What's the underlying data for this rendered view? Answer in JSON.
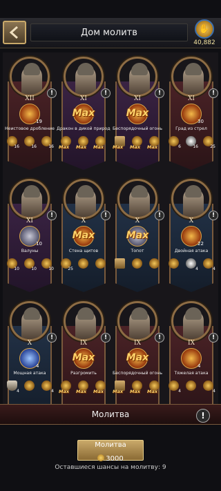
{
  "header": {
    "title": "Дом молитв",
    "currency_value": "40,882"
  },
  "cards": [
    {
      "level": "XII",
      "skill_count": "19",
      "skill_name": "Неистовое дробление",
      "banner": "red",
      "skill_style": "fire",
      "max": false,
      "items": [
        {
          "type": "coin",
          "num": "16"
        },
        {
          "type": "coin",
          "num": "16"
        },
        {
          "type": "coin",
          "num": "16"
        }
      ]
    },
    {
      "level": "XI",
      "skill_count": "",
      "skill_name": "Дракон в дикой природе",
      "banner": "purple",
      "skill_style": "fire",
      "max": true,
      "items": [
        {
          "type": "coin",
          "max": "Max"
        },
        {
          "type": "coin",
          "max": "Max"
        },
        {
          "type": "coin",
          "max": "Max"
        }
      ]
    },
    {
      "level": "XI",
      "skill_count": "",
      "skill_name": "Беспорядочный огонь",
      "banner": "purple",
      "skill_style": "fire",
      "max": true,
      "items": [
        {
          "type": "book",
          "max": "Max"
        },
        {
          "type": "coin",
          "max": "Max"
        },
        {
          "type": "coin",
          "max": "Max"
        }
      ]
    },
    {
      "level": "XI",
      "skill_count": "30",
      "skill_name": "Град из стрел",
      "banner": "red",
      "skill_style": "fire",
      "max": false,
      "items": [
        {
          "type": "coin",
          "num": "6"
        },
        {
          "type": "eye",
          "num": "16"
        },
        {
          "type": "coin",
          "num": "25"
        }
      ]
    },
    {
      "level": "XI",
      "skill_count": "10",
      "skill_name": "Валуны",
      "banner": "purple",
      "skill_style": "gray",
      "max": false,
      "items": [
        {
          "type": "coin",
          "num": "10"
        },
        {
          "type": "coin",
          "num": "10"
        },
        {
          "type": "coin",
          "num": "10"
        }
      ]
    },
    {
      "level": "X",
      "skill_count": "",
      "skill_name": "Стена щитов",
      "banner": "blue",
      "skill_style": "fire",
      "max": true,
      "items": [
        {
          "type": "coin",
          "num": "25"
        },
        {
          "type": "coin",
          "num": ""
        },
        {
          "type": "coin",
          "num": ""
        }
      ]
    },
    {
      "level": "X",
      "skill_count": "",
      "skill_name": "Топот",
      "banner": "blue",
      "skill_style": "gray",
      "max": true,
      "items": [
        {
          "type": "book",
          "num": ""
        },
        {
          "type": "coin",
          "num": ""
        },
        {
          "type": "coin",
          "num": ""
        }
      ]
    },
    {
      "level": "X",
      "skill_count": "22",
      "skill_name": "Двойная атака",
      "banner": "blue",
      "skill_style": "fire",
      "max": false,
      "items": [
        {
          "type": "coin",
          "num": ""
        },
        {
          "type": "eye",
          "num": "4"
        },
        {
          "type": "coin",
          "num": "4"
        }
      ]
    },
    {
      "level": "X",
      "skill_count": "4",
      "skill_name": "Мощная атака",
      "banner": "blue",
      "skill_style": "blue",
      "max": false,
      "items": [
        {
          "type": "shield",
          "num": "4"
        },
        {
          "type": "coin",
          "num": ""
        },
        {
          "type": "coin",
          "num": "4"
        }
      ]
    },
    {
      "level": "IX",
      "skill_count": "",
      "skill_name": "Разгромить",
      "banner": "red",
      "skill_style": "fire",
      "max": true,
      "items": [
        {
          "type": "coin",
          "max": "Max"
        },
        {
          "type": "coin",
          "max": "Max"
        },
        {
          "type": "coin",
          "max": "Max"
        }
      ]
    },
    {
      "level": "IX",
      "skill_count": "",
      "skill_name": "Беспорядочный огонь",
      "banner": "red",
      "skill_style": "fire",
      "max": true,
      "items": [
        {
          "type": "book",
          "max": "Max"
        },
        {
          "type": "coin",
          "max": "Max"
        },
        {
          "type": "coin",
          "max": "Max"
        }
      ]
    },
    {
      "level": "IX",
      "skill_count": "4",
      "skill_name": "Тяжелая атака",
      "banner": "red",
      "skill_style": "fire",
      "max": false,
      "items": [
        {
          "type": "coin",
          "num": "4"
        },
        {
          "type": "coin",
          "num": ""
        },
        {
          "type": "coin",
          "num": "4"
        }
      ]
    }
  ],
  "footer": {
    "prayer_bar_label": "Молитва",
    "pray_button_label": "Молитва",
    "pray_cost": "3000",
    "remaining_text": "Оставшиеся шансы на молитву: 9"
  },
  "max_label": "Max",
  "warn_symbol": "!"
}
